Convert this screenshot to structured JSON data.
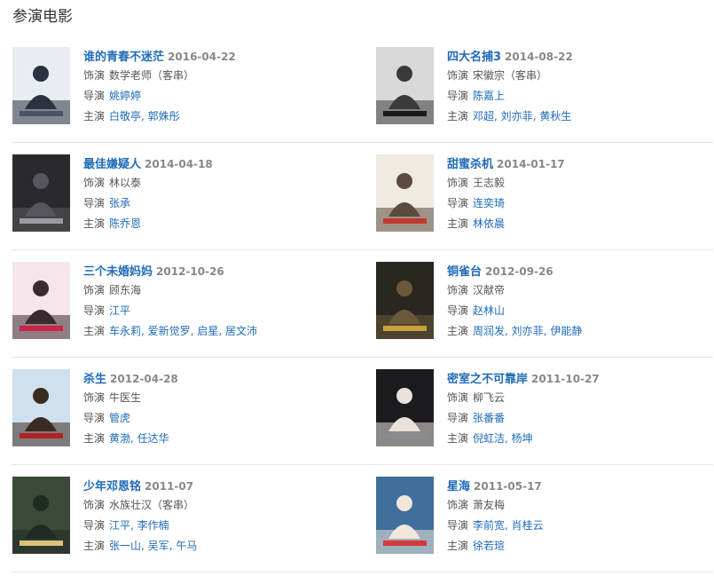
{
  "section": {
    "title": "参演电影"
  },
  "labels": {
    "role": "饰演",
    "director": "导演",
    "starring": "主演"
  },
  "movies": [
    {
      "title": "谁的青春不迷茫",
      "date": "2016-04-22",
      "role": "数学老师（客串）",
      "directors": [
        "姚婷婷"
      ],
      "stars": [
        "白敬亭",
        "郭姝彤"
      ],
      "poster": {
        "bg": "#e9ecf1",
        "accent": "#4a5564",
        "fig": "#2b3140"
      }
    },
    {
      "title": "四大名捕3",
      "date": "2014-08-22",
      "role": "宋徽宗（客串）",
      "directors": [
        "陈嘉上"
      ],
      "stars": [
        "邓超",
        "刘亦菲",
        "黄秋生"
      ],
      "poster": {
        "bg": "#d9d9d9",
        "accent": "#1a1a1a",
        "fig": "#3a3a3a"
      }
    },
    {
      "title": "最佳嫌疑人",
      "date": "2014-04-18",
      "role": "林以泰",
      "directors": [
        "张承"
      ],
      "stars": [
        "陈乔恩"
      ],
      "poster": {
        "bg": "#2a2a2e",
        "accent": "#9a9aa0",
        "fig": "#56565c"
      }
    },
    {
      "title": "甜蜜杀机",
      "date": "2014-01-17",
      "role": "王志毅",
      "directors": [
        "连奕琦"
      ],
      "stars": [
        "林依晨"
      ],
      "poster": {
        "bg": "#efeae2",
        "accent": "#c0392b",
        "fig": "#5a4a40"
      }
    },
    {
      "title": "三个未婚妈妈",
      "date": "2012-10-26",
      "role": "顾东海",
      "directors": [
        "江平"
      ],
      "stars": [
        "车永莉",
        "爱新觉罗",
        "启星",
        "居文沛"
      ],
      "poster": {
        "bg": "#f4e6ea",
        "accent": "#c9254b",
        "fig": "#3b2a30"
      }
    },
    {
      "title": "铜雀台",
      "date": "2012-09-26",
      "role": "汉献帝",
      "directors": [
        "赵林山"
      ],
      "stars": [
        "周润发",
        "刘亦菲",
        "伊能静"
      ],
      "poster": {
        "bg": "#2a2620",
        "accent": "#c8a23a",
        "fig": "#6a5a3a"
      }
    },
    {
      "title": "杀生",
      "date": "2012-04-28",
      "role": "牛医生",
      "directors": [
        "管虎"
      ],
      "stars": [
        "黄渤",
        "任达华"
      ],
      "poster": {
        "bg": "#cfe0ee",
        "accent": "#b22222",
        "fig": "#3a2a20"
      }
    },
    {
      "title": "密室之不可靠岸",
      "date": "2011-10-27",
      "role": "柳飞云",
      "directors": [
        "张番番"
      ],
      "stars": [
        "倪虹洁",
        "杨坤"
      ],
      "poster": {
        "bg": "#1b1b1f",
        "accent": "#8a8a90",
        "fig": "#e8e2d8"
      }
    },
    {
      "title": "少年邓恩铭",
      "date": "2011-07",
      "role": "水族壮汉（客串）",
      "directors": [
        "江平",
        "李作楠"
      ],
      "stars": [
        "张一山",
        "吴军",
        "午马"
      ],
      "poster": {
        "bg": "#3d4a3a",
        "accent": "#d9c27a",
        "fig": "#1f2a22"
      }
    },
    {
      "title": "星海",
      "date": "2011-05-17",
      "role": "萧友梅",
      "directors": [
        "李前宽",
        "肖桂云"
      ],
      "stars": [
        "徐若瑄"
      ],
      "poster": {
        "bg": "#3f6f9a",
        "accent": "#d23b3b",
        "fig": "#f0e6da"
      }
    }
  ]
}
